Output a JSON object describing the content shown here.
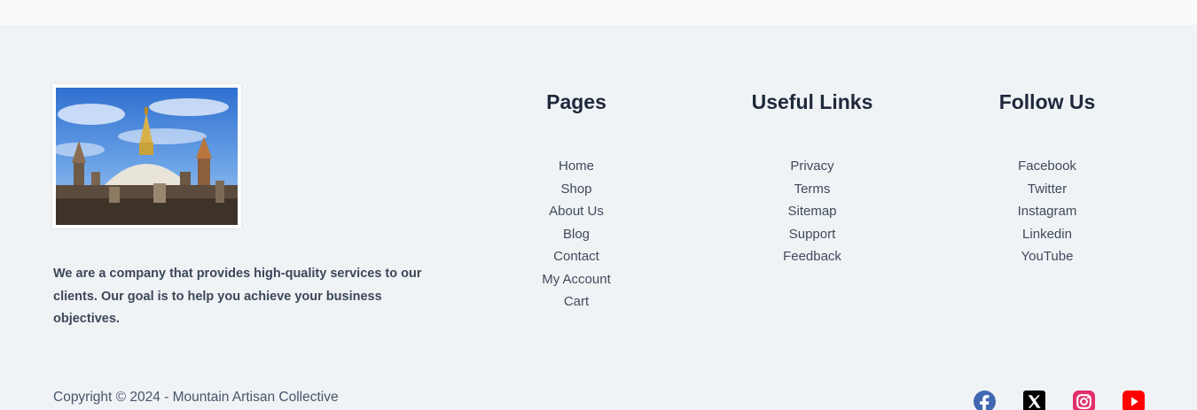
{
  "footer": {
    "logo": {
      "icon": "temple-stupa-photo"
    },
    "about_text": "We are a company that provides high-quality services to our clients. Our goal is to help you achieve your business objectives.",
    "pages": {
      "heading": "Pages",
      "items": [
        "Home",
        "Shop",
        "About Us",
        "Blog",
        "Contact",
        "My Account",
        "Cart"
      ]
    },
    "useful_links": {
      "heading": "Useful Links",
      "items": [
        "Privacy",
        "Terms",
        "Sitemap",
        "Support",
        "Feedback"
      ]
    },
    "follow_us": {
      "heading": "Follow Us",
      "items": [
        "Facebook",
        "Twitter",
        "Instagram",
        "Linkedin",
        "YouTube"
      ]
    },
    "copyright": "Copyright © 2024 - Mountain Artisan Collective",
    "social_icons": [
      {
        "icon": "facebook-icon",
        "color": "#4267b2"
      },
      {
        "icon": "x-icon",
        "color": "#000000"
      },
      {
        "icon": "instagram-icon",
        "color": "#e1306c"
      },
      {
        "icon": "youtube-icon",
        "color": "#ff0000"
      }
    ]
  },
  "colors": {
    "background": "#f0f3f6",
    "top_strip": "#f8fafc",
    "heading": "#1e293b",
    "text": "#3f4a5a"
  }
}
